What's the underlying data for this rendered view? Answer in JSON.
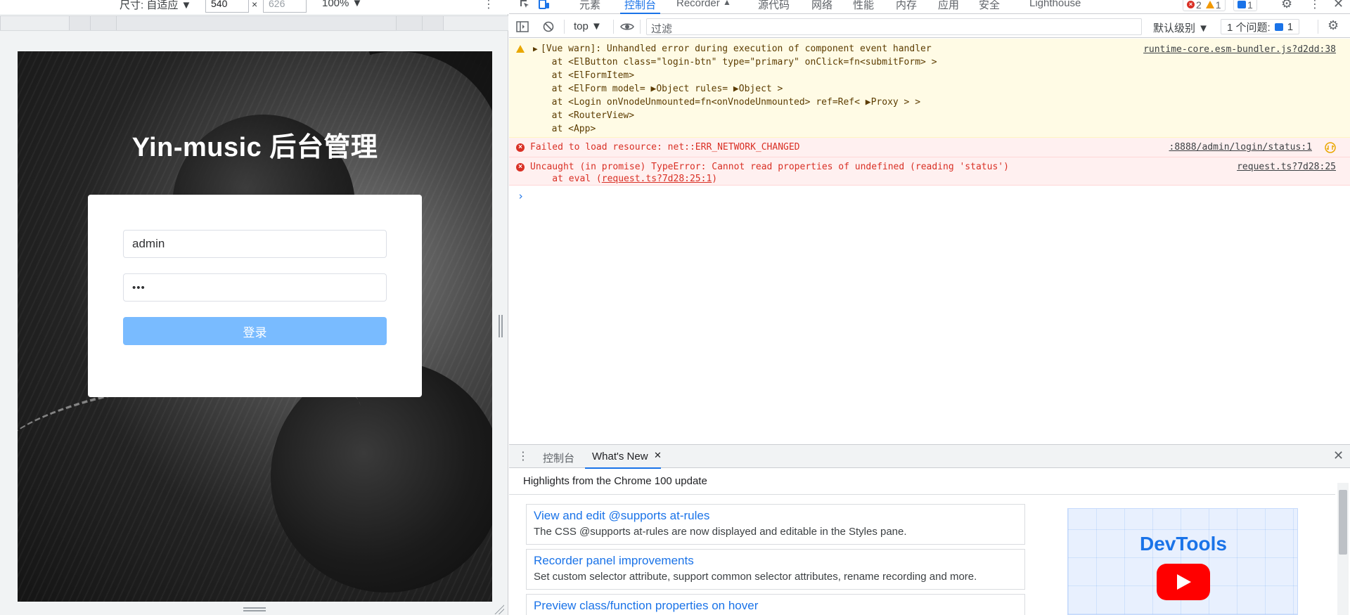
{
  "device_toolbar": {
    "size_label": "尺寸: 自适应 ▼",
    "width_value": "540",
    "times": "×",
    "height_placeholder": "626",
    "zoom": "100% ▼"
  },
  "app": {
    "title": "Yin-music 后台管理",
    "username_value": "admin",
    "password_mask": "•••",
    "login_button": "登录"
  },
  "devtools": {
    "tabs": [
      "元素",
      "控制台",
      "Recorder",
      "源代码",
      "网络",
      "性能",
      "内存",
      "应用",
      "安全",
      "Lighthouse"
    ],
    "active_tab": "控制台",
    "badges": {
      "errors": "2",
      "warnings": "1",
      "messages": "1"
    },
    "console_toolbar": {
      "context": "top ▼",
      "filter_placeholder": "过滤",
      "levels": "默认级别 ▼",
      "issues_label": "1 个问题:",
      "issues_count": "1"
    },
    "messages": {
      "warn": {
        "lines": [
          "[Vue warn]: Unhandled error during execution of component event handler",
          "  at <ElButton class=\"login-btn\" type=\"primary\" onClick=fn<submitForm> >",
          "  at <ElFormItem>",
          "  at <ElForm model= ▶Object rules= ▶Object >",
          "  at <Login onVnodeUnmounted=fn<onVnodeUnmounted> ref=Ref< ▶Proxy > >",
          "  at <RouterView>",
          "  at <App>"
        ],
        "source": "runtime-core.esm-bundler.js?d2dd:38"
      },
      "err1": {
        "text": "Failed to load resource: net::ERR_NETWORK_CHANGED",
        "source": ":8888/admin/login/status:1"
      },
      "err2": {
        "line1": "Uncaught (in promise) TypeError: Cannot read properties of undefined (reading 'status')",
        "line2_prefix": "    at eval (",
        "line2_link": "request.ts?7d28:25:1",
        "line2_suffix": ")",
        "source": "request.ts?7d28:25"
      },
      "prompt": "›"
    },
    "drawer": {
      "tabs": [
        "控制台",
        "What's New"
      ],
      "active_tab": "What's New",
      "close_glyph": "✕",
      "highlights": "Highlights from the Chrome 100 update",
      "features": [
        {
          "title": "View and edit @supports at-rules",
          "desc": "The CSS @supports at-rules are now displayed and editable in the Styles pane."
        },
        {
          "title": "Recorder panel improvements",
          "desc": "Set custom selector attribute, support common selector attributes, rename recording and more."
        },
        {
          "title": "Preview class/function properties on hover",
          "desc": ""
        }
      ],
      "promo_brand": "DevTools"
    }
  },
  "colors": {
    "accent": "#1a73e8",
    "error": "#d93025",
    "warning": "#f29900",
    "login_button": "#79bbff"
  }
}
